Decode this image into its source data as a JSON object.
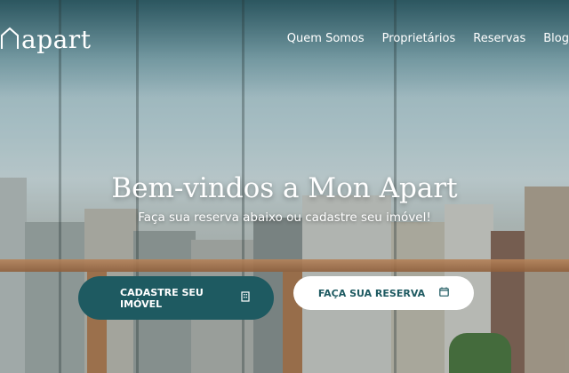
{
  "header": {
    "logo_text": "apart",
    "nav": [
      {
        "label": "Quem Somos"
      },
      {
        "label": "Proprietários"
      },
      {
        "label": "Reservas"
      },
      {
        "label": "Blog"
      }
    ]
  },
  "hero": {
    "title": "Bem-vindos a Mon Apart",
    "subtitle": "Faça sua reserva abaixo ou cadastre seu imóvel!",
    "primary_button": {
      "label": "CADASTRE SEU IMÓVEL",
      "icon": "building-icon"
    },
    "secondary_button": {
      "label": "FAÇA SUA RESERVA",
      "icon": "calendar-icon"
    }
  },
  "colors": {
    "brand": "#1e5a61",
    "text_on_dark": "#ffffff"
  }
}
